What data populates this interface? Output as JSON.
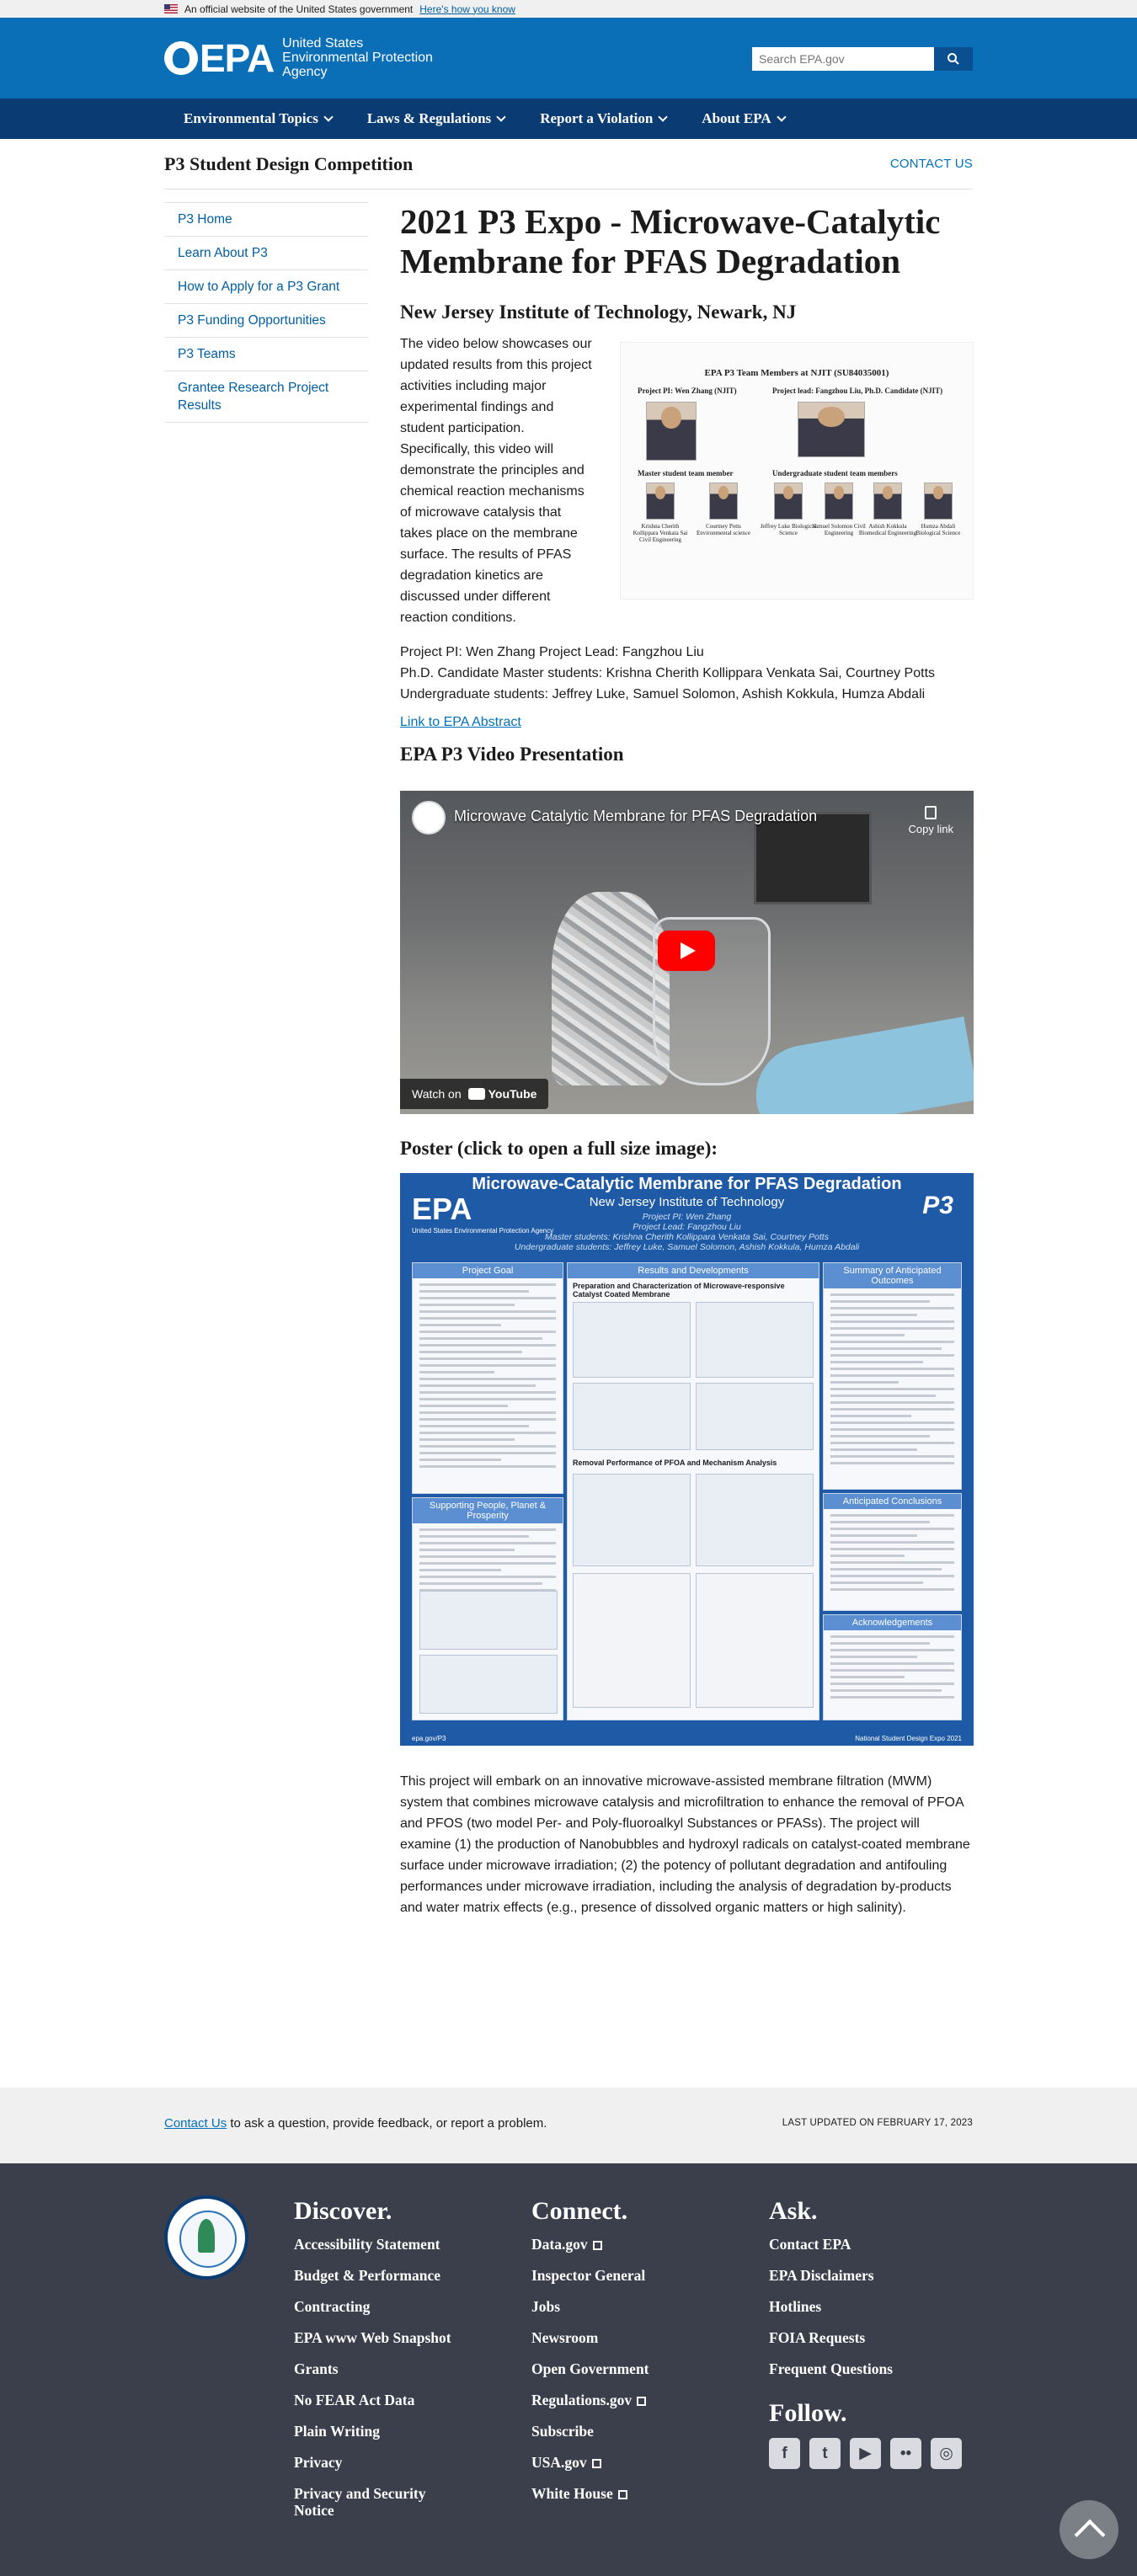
{
  "gov_banner": {
    "text": "An official website of the United States government",
    "link": "Here's how you know"
  },
  "header": {
    "logo": "EPA",
    "agency": [
      "United States",
      "Environmental Protection",
      "Agency"
    ],
    "search_placeholder": "Search EPA.gov"
  },
  "nav": [
    "Environmental Topics",
    "Laws & Regulations",
    "Report a Violation",
    "About EPA"
  ],
  "microsite": {
    "title": "P3 Student Design Competition",
    "contact": "CONTACT US"
  },
  "sidebar": {
    "items": [
      {
        "label": "P3 Home"
      },
      {
        "label": "Learn About P3"
      },
      {
        "label": "How to Apply for a P3 Grant"
      },
      {
        "label": "P3 Funding Opportunities"
      },
      {
        "label": "P3 Teams"
      },
      {
        "label": "Grantee Research Project Results"
      }
    ]
  },
  "main": {
    "title": "2021 P3 Expo - Microwave-Catalytic Membrane for PFAS Degradation",
    "institution": "New Jersey Institute of Technology, Newark, NJ",
    "intro": "The video below showcases our updated results from this project activities including major experimental findings and student participation. Specifically, this video will demonstrate the principles and chemical reaction mechanisms of microwave catalysis that takes place on the membrane surface. The results of PFAS degradation kinetics are discussed under different reaction conditions.",
    "team_figure": {
      "title": "EPA P3 Team Members at NJIT (SU84035001)",
      "pi_label": "Project PI: Wen Zhang (NJIT)",
      "lead_label": "Project lead: Fangzhou Liu, Ph.D. Candidate (NJIT)",
      "master_label": "Master student team member",
      "undergrad_label": "Undergraduate student team members",
      "captions": [
        "Krishna Cherith Kollippara Venkata Sai Civil Engineering",
        "Courtney Potts Environmental science",
        "Jeffrey Luke Biological Science",
        "Samuel Solomon Civil Engineering",
        "Ashish Kokkula Biomedical Engineering",
        "Humza Abdali Biological Science"
      ]
    },
    "credits": [
      "Project PI: Wen Zhang Project Lead: Fangzhou Liu",
      "Ph.D. Candidate Master students: Krishna Cherith Kollippara Venkata Sai, Courtney Potts",
      "Undergraduate students: Jeffrey Luke, Samuel Solomon, Ashish Kokkula, Humza Abdali"
    ],
    "abstract_link": "Link to EPA Abstract",
    "video_heading": "EPA P3 Video Presentation",
    "video": {
      "title": "Microwave Catalytic Membrane for PFAS Degradation",
      "copy_link": "Copy link",
      "watch_on": "Watch on",
      "youtube": "YouTube"
    },
    "poster_heading": "Poster (click to open a full size image):",
    "poster": {
      "title": "Microwave-Catalytic Membrane for PFAS Degradation",
      "institution": "New Jersey Institute of Technology",
      "pi": "Project PI: Wen Zhang",
      "lead": "Project Lead: Fangzhou Liu",
      "masters": "Master students: Krishna Cherith Kollippara Venkata Sai, Courtney Potts",
      "undergrads": "Undergraduate students: Jeffrey Luke, Samuel Solomon, Ashish Kokkula, Humza Abdali",
      "logo": "EPA",
      "logo_sub": "United States Environmental Protection Agency",
      "p3": "P3",
      "panels": [
        "Project Goal",
        "Results and Developments",
        "Summary of Anticipated Outcomes",
        "Supporting People, Planet & Prosperity",
        "Anticipated Conclusions",
        "Acknowledgements"
      ],
      "section_a": "Preparation and Characterization of Microwave-responsive Catalyst Coated Membrane",
      "section_b": "Removal Performance of PFOA and Mechanism Analysis",
      "footer_left": "epa.gov/P3",
      "footer_right": "National Student Design Expo 2021"
    },
    "description": "This project will embark on an innovative microwave-assisted membrane filtration (MWM) system that combines microwave catalysis and microfiltration to enhance the removal of PFOA and PFOS (two model Per- and Poly-fluoroalkyl Substances or PFASs). The project will examine (1) the production of Nanobubbles and hydroxyl radicals on catalyst-coated membrane surface under microwave irradiation; (2) the potency of pollutant degradation and antifouling performances under microwave irradiation, including the analysis of degradation by-products and water matrix effects (e.g., presence of dissolved organic matters or high salinity)."
  },
  "contact_band": {
    "link": "Contact Us",
    "text": " to ask a question, provide feedback, or report a problem.",
    "updated": "LAST UPDATED ON FEBRUARY 17, 2023"
  },
  "footer": {
    "discover": {
      "heading": "Discover.",
      "links": [
        "Accessibility Statement",
        "Budget & Performance",
        "Contracting",
        "EPA www Web Snapshot",
        "Grants",
        "No FEAR Act Data",
        "Plain Writing",
        "Privacy",
        "Privacy and Security Notice"
      ]
    },
    "connect": {
      "heading": "Connect.",
      "links": [
        "Data.gov",
        "Inspector General",
        "Jobs",
        "Newsroom",
        "Open Government",
        "Regulations.gov",
        "Subscribe",
        "USA.gov",
        "White House"
      ]
    },
    "ask": {
      "heading": "Ask.",
      "links": [
        "Contact EPA",
        "EPA Disclaimers",
        "Hotlines",
        "FOIA Requests",
        "Frequent Questions"
      ]
    },
    "follow": {
      "heading": "Follow."
    }
  }
}
